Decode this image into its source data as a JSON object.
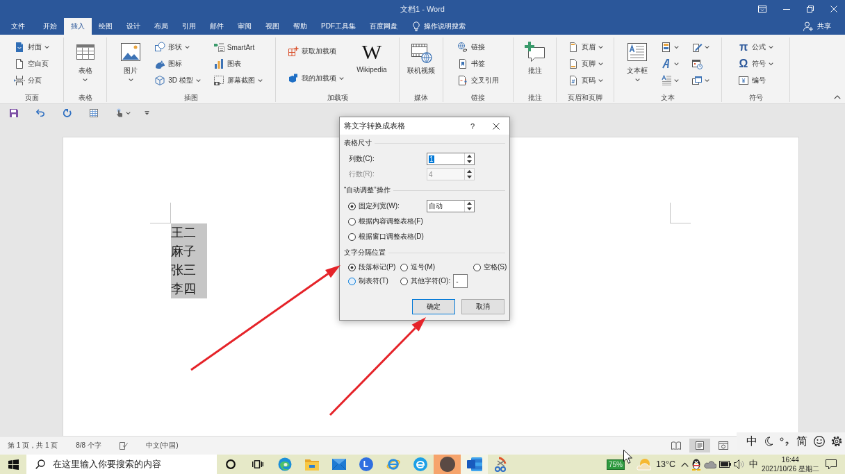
{
  "window": {
    "title": "文档1 - Word"
  },
  "tabs": [
    {
      "label": "文件",
      "selected": false
    },
    {
      "label": "开始",
      "selected": false
    },
    {
      "label": "插入",
      "selected": true
    },
    {
      "label": "绘图",
      "selected": false
    },
    {
      "label": "设计",
      "selected": false
    },
    {
      "label": "布局",
      "selected": false
    },
    {
      "label": "引用",
      "selected": false
    },
    {
      "label": "邮件",
      "selected": false
    },
    {
      "label": "审阅",
      "selected": false
    },
    {
      "label": "视图",
      "selected": false
    },
    {
      "label": "帮助",
      "selected": false
    },
    {
      "label": "PDF工具集",
      "selected": false
    },
    {
      "label": "百度网盘",
      "selected": false
    }
  ],
  "tell_me": {
    "label": "操作说明搜索"
  },
  "share": {
    "label": "共享"
  },
  "ribbon": {
    "groups": [
      {
        "label": "页面",
        "columns": [
          [
            {
              "kind": "small",
              "label": "封面",
              "dropdown": true
            },
            {
              "kind": "small",
              "label": "空白页",
              "dropdown": false
            },
            {
              "kind": "small",
              "label": "分页",
              "dropdown": false
            }
          ]
        ]
      },
      {
        "label": "表格",
        "columns": [
          [
            {
              "kind": "large",
              "label": "表格",
              "dropdown": true
            }
          ]
        ]
      },
      {
        "label": "插图",
        "columns": [
          [
            {
              "kind": "large",
              "label": "图片",
              "dropdown": true
            }
          ],
          [
            {
              "kind": "small",
              "label": "形状",
              "dropdown": true
            },
            {
              "kind": "small",
              "label": "图标",
              "dropdown": false
            },
            {
              "kind": "small",
              "label": "3D 模型",
              "dropdown": true
            }
          ],
          [
            {
              "kind": "small",
              "label": "SmartArt",
              "dropdown": false
            },
            {
              "kind": "small",
              "label": "图表",
              "dropdown": false
            },
            {
              "kind": "small",
              "label": "屏幕截图",
              "dropdown": true
            }
          ]
        ]
      },
      {
        "label": "加载项",
        "columns": [
          [
            {
              "kind": "small",
              "label": "获取加载项",
              "dropdown": false
            },
            {
              "kind": "small",
              "label": "我的加载项",
              "dropdown": true
            }
          ],
          [
            {
              "kind": "large",
              "label": "Wikipedia",
              "glyph": "W",
              "dropdown": false
            }
          ]
        ]
      },
      {
        "label": "媒体",
        "columns": [
          [
            {
              "kind": "large",
              "label": "联机视频",
              "dropdown": false
            }
          ]
        ]
      },
      {
        "label": "链接",
        "columns": [
          [
            {
              "kind": "small",
              "label": "链接",
              "dropdown": false
            },
            {
              "kind": "small",
              "label": "书签",
              "dropdown": false
            },
            {
              "kind": "small",
              "label": "交叉引用",
              "dropdown": false
            }
          ]
        ]
      },
      {
        "label": "批注",
        "columns": [
          [
            {
              "kind": "large",
              "label": "批注",
              "dropdown": false
            }
          ]
        ]
      },
      {
        "label": "页眉和页脚",
        "columns": [
          [
            {
              "kind": "small",
              "label": "页眉",
              "dropdown": true
            },
            {
              "kind": "small",
              "label": "页脚",
              "dropdown": true
            },
            {
              "kind": "small",
              "label": "页码",
              "dropdown": true
            }
          ]
        ]
      },
      {
        "label": "文本",
        "columns": [
          [
            {
              "kind": "large",
              "label": "文本框",
              "dropdown": true
            }
          ],
          [
            {
              "kind": "icon",
              "dropdown": true
            },
            {
              "kind": "icon",
              "dropdown": true
            },
            {
              "kind": "icon",
              "dropdown": true
            }
          ],
          [
            {
              "kind": "icon",
              "dropdown": true
            },
            {
              "kind": "icon",
              "dropdown": false
            },
            {
              "kind": "icon",
              "dropdown": true
            }
          ]
        ]
      },
      {
        "label": "符号",
        "columns": [
          [
            {
              "kind": "small",
              "label": "公式",
              "glyph": "π",
              "dropdown": true
            },
            {
              "kind": "small",
              "label": "符号",
              "glyph": "Ω",
              "dropdown": true
            },
            {
              "kind": "small",
              "label": "编号",
              "dropdown": false
            }
          ]
        ]
      }
    ]
  },
  "document": {
    "lines": [
      "王二",
      "麻子",
      "张三",
      "李四"
    ],
    "selected": true
  },
  "dialog": {
    "title": "将文字转换成表格",
    "help": "?",
    "table_size": {
      "heading": "表格尺寸",
      "fields": [
        {
          "label": "列数(C):",
          "value": "1",
          "value_selected": true,
          "disabled": false
        },
        {
          "label": "行数(R):",
          "value": "4",
          "value_selected": false,
          "disabled": true
        }
      ]
    },
    "autofit": {
      "heading": "“自动调整”操作",
      "options": [
        {
          "label": "固定列宽(W):",
          "selected": true,
          "value": "自动"
        },
        {
          "label": "根据内容调整表格(F)",
          "selected": false
        },
        {
          "label": "根据窗口调整表格(D)",
          "selected": false
        }
      ]
    },
    "separator": {
      "heading": "文字分隔位置",
      "options": [
        {
          "label": "段落标记(P)",
          "selected": true,
          "focused": false
        },
        {
          "label": "逗号(M)",
          "selected": false,
          "focused": false
        },
        {
          "label": "空格(S)",
          "selected": false,
          "focused": false
        },
        {
          "label": "制表符(T)",
          "selected": false,
          "focused": true
        },
        {
          "label": "其他字符(O):",
          "selected": false,
          "focused": false,
          "value": "-"
        }
      ]
    },
    "buttons": [
      {
        "label": "确定",
        "default": true
      },
      {
        "label": "取消",
        "default": false
      }
    ]
  },
  "status_bar": {
    "page": "第 1 页，共 1 页",
    "word_count": "8/8 个字",
    "language": "中文(中国)",
    "views": [
      {
        "selected": false
      },
      {
        "selected": true
      },
      {
        "selected": false
      }
    ]
  },
  "ime_toolbar": {
    "mode": "中",
    "script": "简"
  },
  "taskbar": {
    "search_placeholder": "在这里输入你要搜索的内容",
    "apps": [
      {
        "active": false,
        "flashing": false
      },
      {
        "active": false,
        "flashing": false
      },
      {
        "active": false,
        "flashing": false
      },
      {
        "glyph": "L",
        "active": false,
        "flashing": false
      },
      {
        "active": false,
        "flashing": false
      },
      {
        "active": false,
        "flashing": false
      },
      {
        "active": false,
        "flashing": true
      },
      {
        "active": true,
        "flashing": false
      },
      {
        "active": false,
        "flashing": false
      }
    ],
    "battery_badge": "75%",
    "temperature": "13°C",
    "input_method": "中",
    "time": "16:44",
    "date": "2021/10/26 星期二"
  }
}
